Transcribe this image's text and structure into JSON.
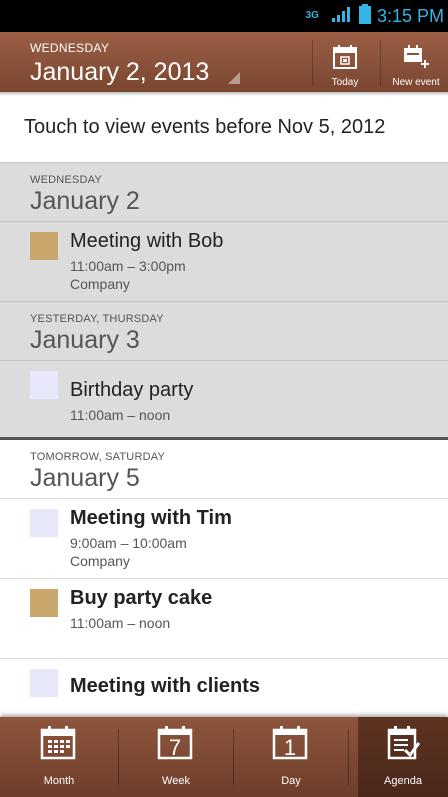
{
  "status_bar": {
    "network": "3G",
    "time": "3:15 PM"
  },
  "header": {
    "weekday": "WEDNESDAY",
    "date": "January 2, 2013",
    "today_label": "Today",
    "new_event_label": "New event"
  },
  "banner": {
    "text": "Touch to view events before Nov 5, 2012"
  },
  "days": [
    {
      "relative": "WEDNESDAY",
      "date": "January 2",
      "events": [
        {
          "title": "Meeting with Bob",
          "time": "11:00am – 3:00pm",
          "calendar": "Company",
          "color": "#c9a66b"
        }
      ]
    },
    {
      "relative": "YESTERDAY, THURSDAY",
      "date": "January 3",
      "events": [
        {
          "title": "Birthday party",
          "time": "11:00am – noon",
          "calendar": "",
          "color": "#e8e8fb"
        }
      ]
    },
    {
      "relative": "TOMORROW, SATURDAY",
      "date": "January 5",
      "events": [
        {
          "title": "Meeting with Tim",
          "time": "9:00am – 10:00am",
          "calendar": "Company",
          "color": "#e8e8fb"
        },
        {
          "title": "Buy party cake",
          "time": "11:00am – noon",
          "calendar": "",
          "color": "#c9a66b"
        },
        {
          "title": "Meeting with clients",
          "time": "",
          "calendar": "",
          "color": "#e8e8fb"
        }
      ]
    }
  ],
  "tabs": [
    {
      "label": "Month",
      "icon": "month-grid-icon",
      "active": false
    },
    {
      "label": "Week",
      "icon": "week-calendar-icon",
      "number": "7",
      "active": false
    },
    {
      "label": "Day",
      "icon": "day-calendar-icon",
      "number": "1",
      "active": false
    },
    {
      "label": "Agenda",
      "icon": "agenda-checklist-icon",
      "active": true
    }
  ],
  "colors": {
    "brand_brown": "#8a5139",
    "status_blue": "#33b5e5",
    "past_bg": "#dcdcdc",
    "tan_calendar": "#c9a66b",
    "lavender_calendar": "#e8e8fb"
  }
}
